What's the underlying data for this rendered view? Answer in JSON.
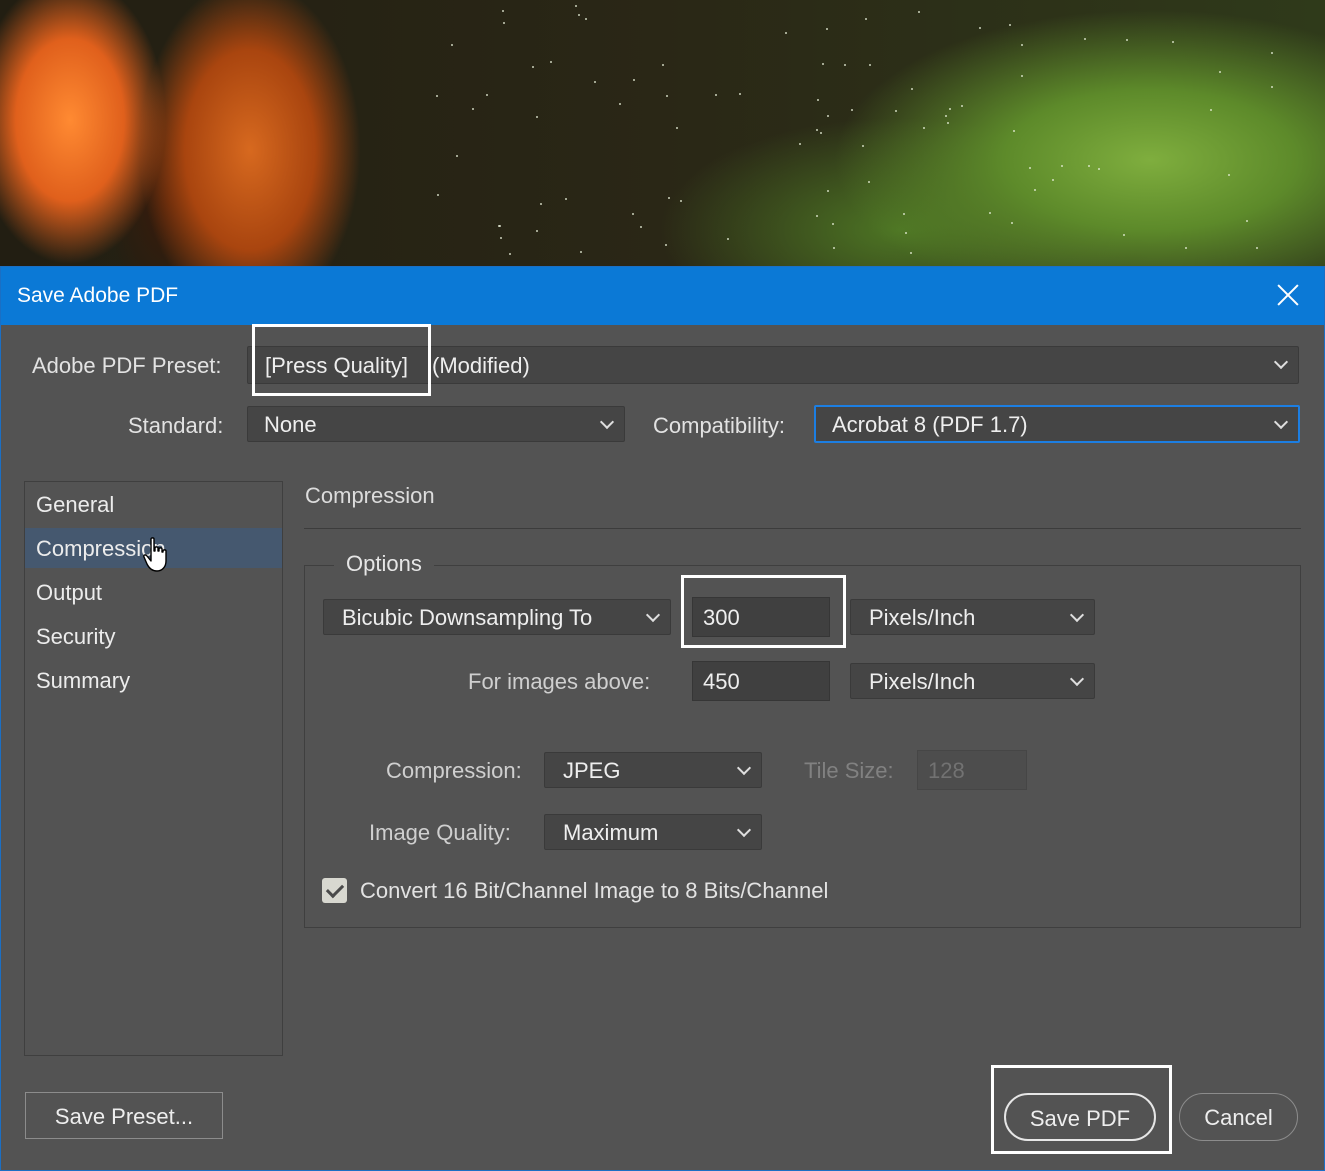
{
  "dialog": {
    "title": "Save Adobe PDF"
  },
  "preset": {
    "label": "Adobe PDF Preset:",
    "value_name": "[Press Quality]",
    "value_suffix": "(Modified)"
  },
  "standard": {
    "label": "Standard:",
    "value": "None"
  },
  "compatibility": {
    "label": "Compatibility:",
    "value": "Acrobat 8 (PDF 1.7)"
  },
  "sidebar": {
    "items": [
      {
        "label": "General"
      },
      {
        "label": "Compression",
        "selected": true
      },
      {
        "label": "Output"
      },
      {
        "label": "Security"
      },
      {
        "label": "Summary"
      }
    ]
  },
  "panel": {
    "heading": "Compression",
    "options_group": "Options",
    "downsampling": {
      "method": "Bicubic Downsampling To",
      "resolution": "300",
      "unit": "Pixels/Inch"
    },
    "images_above": {
      "label": "For images above:",
      "value": "450",
      "unit": "Pixels/Inch"
    },
    "compression": {
      "label": "Compression:",
      "value": "JPEG"
    },
    "tile_size": {
      "label": "Tile Size:",
      "value": "128",
      "disabled": true
    },
    "image_quality": {
      "label": "Image Quality:",
      "value": "Maximum"
    },
    "convert_16bit": {
      "label": "Convert 16 Bit/Channel Image to 8 Bits/Channel",
      "checked": true
    }
  },
  "buttons": {
    "save_preset": "Save Preset...",
    "save_pdf": "Save PDF",
    "cancel": "Cancel"
  },
  "colors": {
    "titlebar": "#0b79d6",
    "dialog_bg": "#535353",
    "selected_item": "#45586f",
    "focus_ring": "#1c7ee2",
    "highlight": "#ffffff"
  }
}
